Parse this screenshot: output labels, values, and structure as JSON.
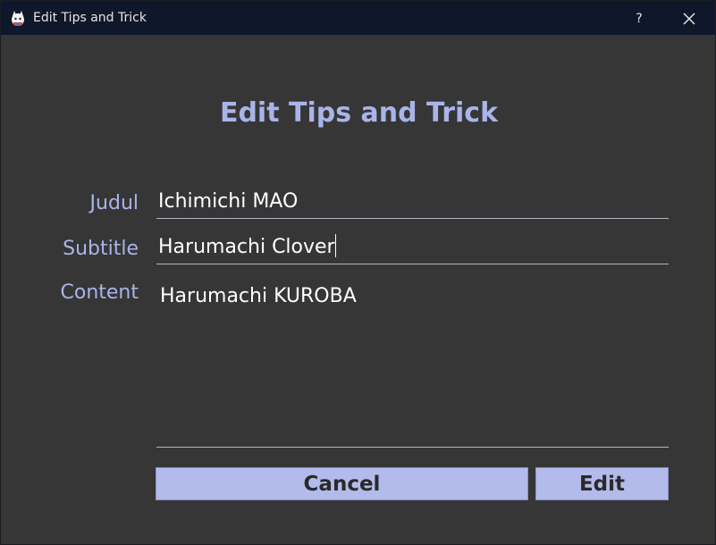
{
  "window": {
    "title": "Edit Tips and Trick",
    "help_label": "?"
  },
  "form": {
    "heading": "Edit Tips and Trick",
    "fields": [
      {
        "label": "Judul",
        "value": "Ichimichi MAO"
      },
      {
        "label": "Subtitle",
        "value": "Harumachi Clover"
      },
      {
        "label": "Content",
        "value": "Harumachi KUROBA"
      }
    ]
  },
  "buttons": {
    "cancel": "Cancel",
    "edit": "Edit"
  },
  "colors": {
    "accent": "#a9b4e9",
    "button_bg": "#b3bbeb",
    "titlebar_bg": "#0f172a",
    "window_bg": "#363636"
  },
  "icons": {
    "app": "app-mascot-icon",
    "close": "close-icon"
  }
}
